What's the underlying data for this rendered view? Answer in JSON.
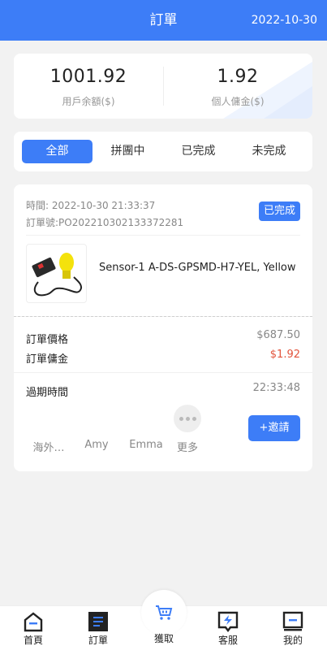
{
  "header": {
    "title": "訂單",
    "date": "2022-10-30"
  },
  "stats": {
    "balance_value": "1001.92",
    "balance_label": "用戶余額($)",
    "commission_value": "1.92",
    "commission_label": "個人傭金($)"
  },
  "tabs": [
    {
      "label": "全部",
      "active": true
    },
    {
      "label": "拼團中",
      "active": false
    },
    {
      "label": "已完成",
      "active": false
    },
    {
      "label": "未完成",
      "active": false
    }
  ],
  "order": {
    "time": "時間: 2022-10-30 21:33:37",
    "order_no": "訂單號:PO202210302133372281",
    "status": "已完成",
    "product_name": "Sensor-1 A-DS-GPSMD-H7-YEL, Yellow",
    "price_label": "訂單價格",
    "price_value": "$687.50",
    "commission_label": "訂單傭金",
    "commission_value": "$1.92",
    "expire_label": "過期時間",
    "expire_value": "22:33:48"
  },
  "participants": [
    "海外…",
    "Amy",
    "Emma",
    "更多"
  ],
  "invite_label": "+邀請",
  "tabbar": [
    {
      "label": "首頁",
      "icon": "home-icon"
    },
    {
      "label": "訂單",
      "icon": "order-icon"
    },
    {
      "label": "獲取",
      "icon": "cart-icon"
    },
    {
      "label": "客服",
      "icon": "service-icon"
    },
    {
      "label": "我的",
      "icon": "profile-icon"
    }
  ],
  "colors": {
    "primary": "#3d7df7",
    "commission": "#e2543c"
  }
}
